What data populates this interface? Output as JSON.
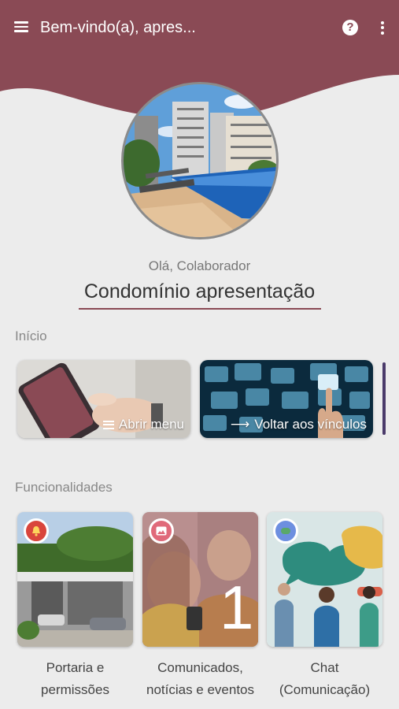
{
  "header": {
    "title": "Bem-vindo(a), apres...",
    "menu_icon": "hamburger-menu-icon",
    "help_icon": "help-circle-icon",
    "more_icon": "more-vertical-icon",
    "color": "#8a4a55"
  },
  "profile": {
    "greeting": "Olá, Colaborador",
    "condominium": "Condomínio apresentação"
  },
  "sections": {
    "inicio": "Início",
    "funcionalidades": "Funcionalidades"
  },
  "shortcuts": [
    {
      "label": "Abrir menu",
      "icon": "hamburger-icon"
    },
    {
      "label": "Voltar aos vínculos",
      "icon": "arrow-right-icon"
    }
  ],
  "features": [
    {
      "label": "Portaria e permissões",
      "badge_icon": "bell-icon",
      "badge_color": "#d9453c"
    },
    {
      "label": "Comunicados, notícias e eventos",
      "badge_icon": "image-icon",
      "badge_color": "#e06a7a",
      "overlay_number": "1"
    },
    {
      "label": "Chat (Comunicação)",
      "badge_icon": "chat-icon",
      "badge_color": "#6d8fe0"
    }
  ]
}
